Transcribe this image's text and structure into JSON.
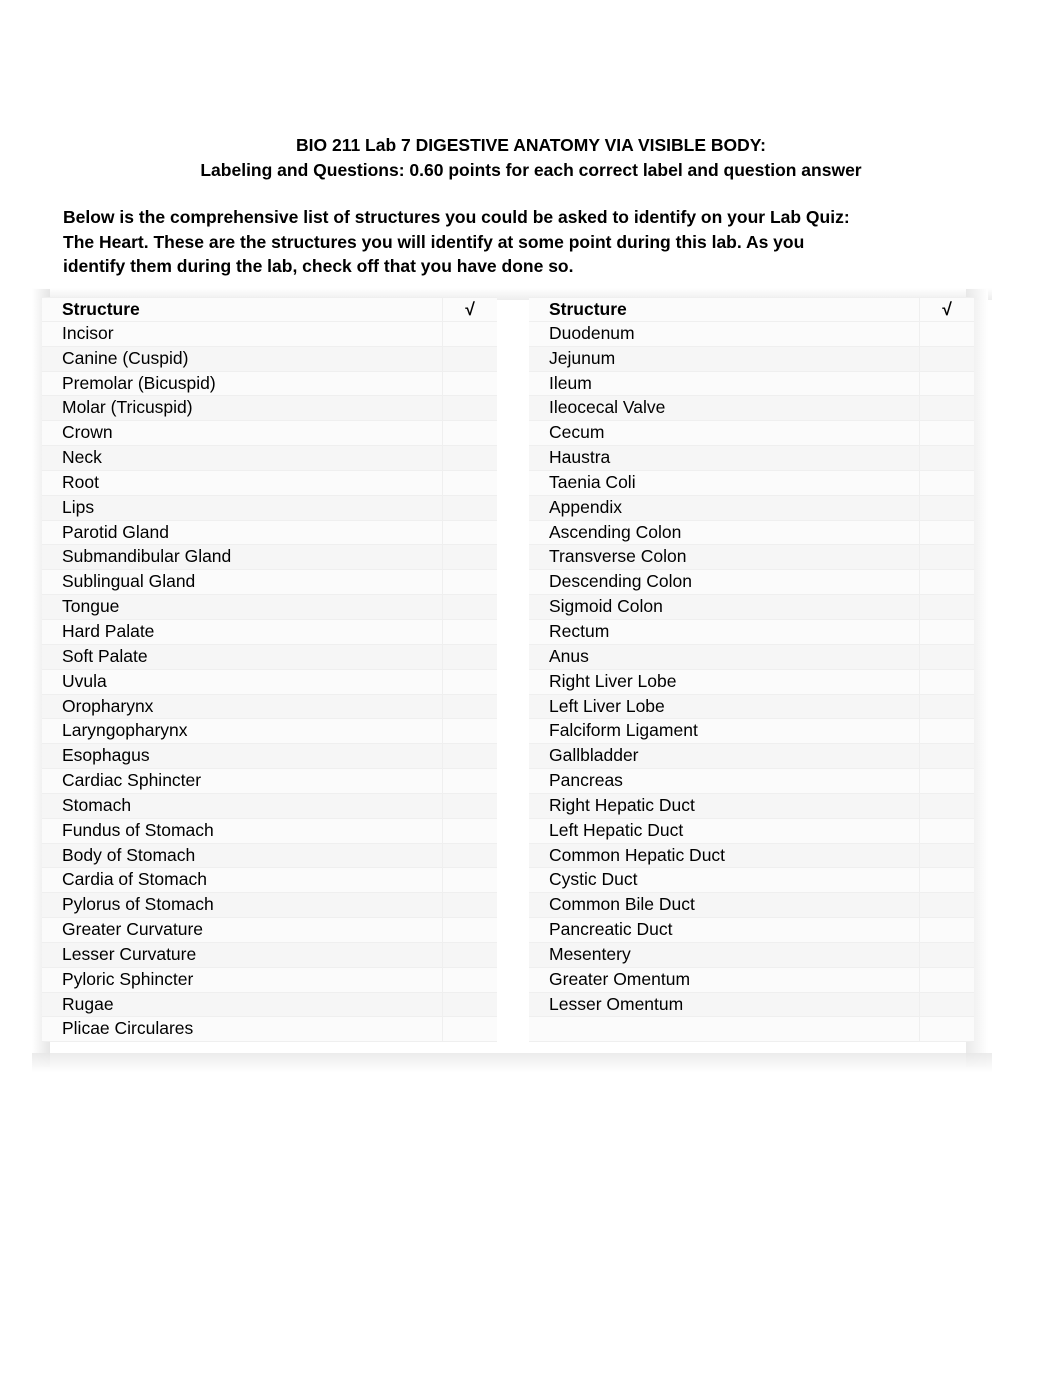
{
  "document": {
    "title_lines": [
      "BIO 211 Lab 7 DIGESTIVE ANATOMY VIA VISIBLE BODY:",
      "Labeling and Questions: 0.60 points for each correct label and question answer"
    ],
    "intro_lines": [
      "Below is the comprehensive list of structures you could be asked to identify on your Lab Quiz:",
      "The Heart. These are the structures you will identify at some point during this lab. As you",
      "identify them during the lab, check off that you have done so."
    ]
  },
  "table": {
    "header": {
      "structure_label": "Structure",
      "check_label": "√"
    },
    "left_column": [
      "Incisor",
      "Canine (Cuspid)",
      "Premolar (Bicuspid)",
      "Molar (Tricuspid)",
      "Crown",
      "Neck",
      "Root",
      "Lips",
      "Parotid Gland",
      "Submandibular Gland",
      "Sublingual Gland",
      "Tongue",
      "Hard Palate",
      "Soft Palate",
      "Uvula",
      "Oropharynx",
      "Laryngopharynx",
      "Esophagus",
      "Cardiac Sphincter",
      "Stomach",
      "Fundus of Stomach",
      "Body of Stomach",
      "Cardia of Stomach",
      "Pylorus of Stomach",
      "Greater Curvature",
      "Lesser Curvature",
      "Pyloric Sphincter",
      "Rugae",
      "Plicae Circulares"
    ],
    "right_column": [
      "Duodenum",
      "Jejunum",
      "Ileum",
      "Ileocecal Valve",
      "Cecum",
      "Haustra",
      "Taenia Coli",
      "Appendix",
      "Ascending Colon",
      "Transverse Colon",
      "Descending Colon",
      "Sigmoid Colon",
      "Rectum",
      "Anus",
      "Right Liver Lobe",
      "Left Liver Lobe",
      "Falciform Ligament",
      "Gallbladder",
      "Pancreas",
      "Right Hepatic Duct",
      "Left Hepatic Duct",
      "Common Hepatic Duct",
      "Cystic Duct",
      "Common Bile Duct",
      "Pancreatic Duct",
      "Mesentery",
      "Greater Omentum",
      "Lesser Omentum",
      ""
    ],
    "check_values": []
  },
  "colors": {
    "page_background": "#ffffff",
    "text": "#000000",
    "row_background": "#fbfbfb",
    "row_alt_background": "#f6f6f6",
    "row_border": "#efefef"
  }
}
